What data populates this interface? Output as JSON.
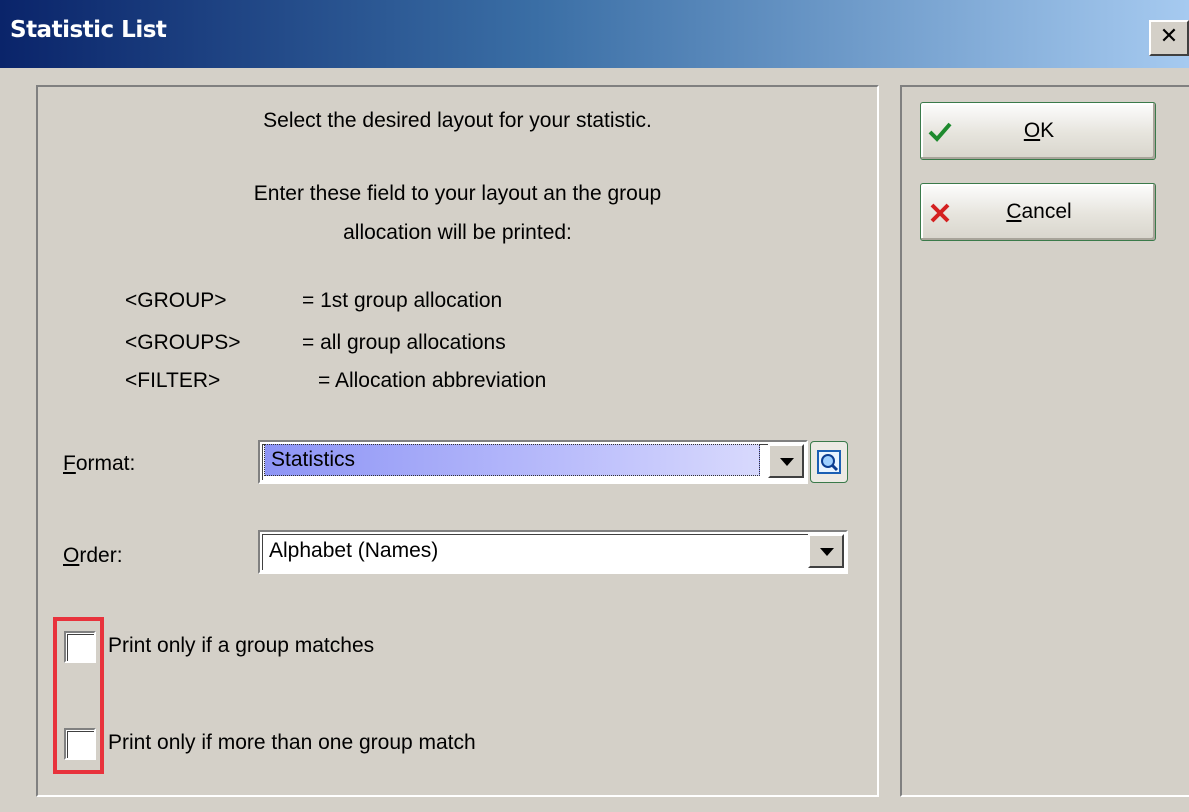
{
  "window": {
    "title": "Statistic List",
    "close_label": "✕"
  },
  "instructions": {
    "line1": "Select the desired layout for your statistic.",
    "line2": "Enter these field to your layout an the group",
    "line3": "allocation will be printed:",
    "placeholders": [
      {
        "token": "<GROUP>",
        "meaning": "= 1st group allocation"
      },
      {
        "token": "<GROUPS>",
        "meaning": "= all group allocations"
      },
      {
        "token": "<FILTER>",
        "meaning": "= Allocation abbreviation"
      }
    ]
  },
  "format": {
    "label_mnemonic": "F",
    "label_rest": "ormat:",
    "value": "Statistics"
  },
  "order": {
    "label_mnemonic": "O",
    "label_rest": "rder:",
    "value": "Alphabet (Names)"
  },
  "options": {
    "group_matches": {
      "label": "Print only if a group matches",
      "checked": false
    },
    "more_than_one": {
      "label": "Print only if more than one group match",
      "checked": false
    }
  },
  "buttons": {
    "ok_mnemonic": "O",
    "ok_rest": "K",
    "cancel_mnemonic": "C",
    "cancel_rest": "ancel"
  },
  "icons": {
    "ok": "checkmark-icon",
    "cancel": "x-icon",
    "lookup": "magnifier-icon"
  },
  "colors": {
    "titlebar_start": "#0a246a",
    "titlebar_end": "#a6caf0",
    "highlight_box": "#e8323c",
    "format_selection": "#8d94f5"
  }
}
